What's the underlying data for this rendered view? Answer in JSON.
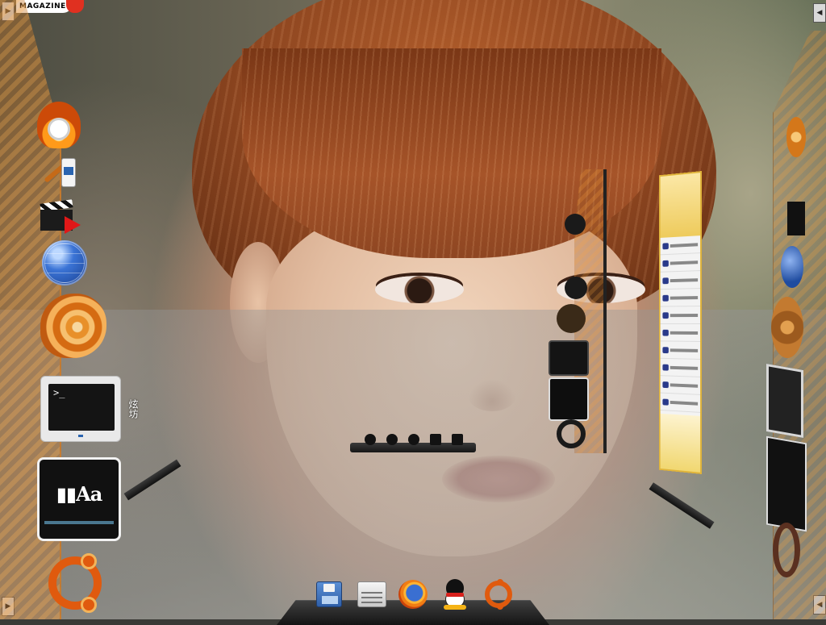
{
  "wallpaper": {
    "description_icon": "portrait-wallpaper"
  },
  "top_label": {
    "text": "MAGAZINE"
  },
  "left_dock": {
    "terminal_prompt": ">_",
    "font_viewer_text": "Aa",
    "side_label": "炫坊"
  },
  "colors": {
    "panel_orange": "#d98a3a",
    "dock_dark": "#1c1c1c",
    "ubuntu_orange": "#e05a0e",
    "qq_yellow": "#eecb5c"
  },
  "icons": {
    "left": [
      "cd-burner-icon",
      "gimp-icon",
      "video-editor-icon",
      "web-browser-icon",
      "file-manager-shell-icon",
      "terminal-icon",
      "font-viewer-icon",
      "ubuntu-logo-icon"
    ],
    "bottom": [
      "save-disk-icon",
      "drive-icon",
      "firefox-icon",
      "qq-penguin-icon",
      "ubuntu-logo-icon"
    ]
  }
}
